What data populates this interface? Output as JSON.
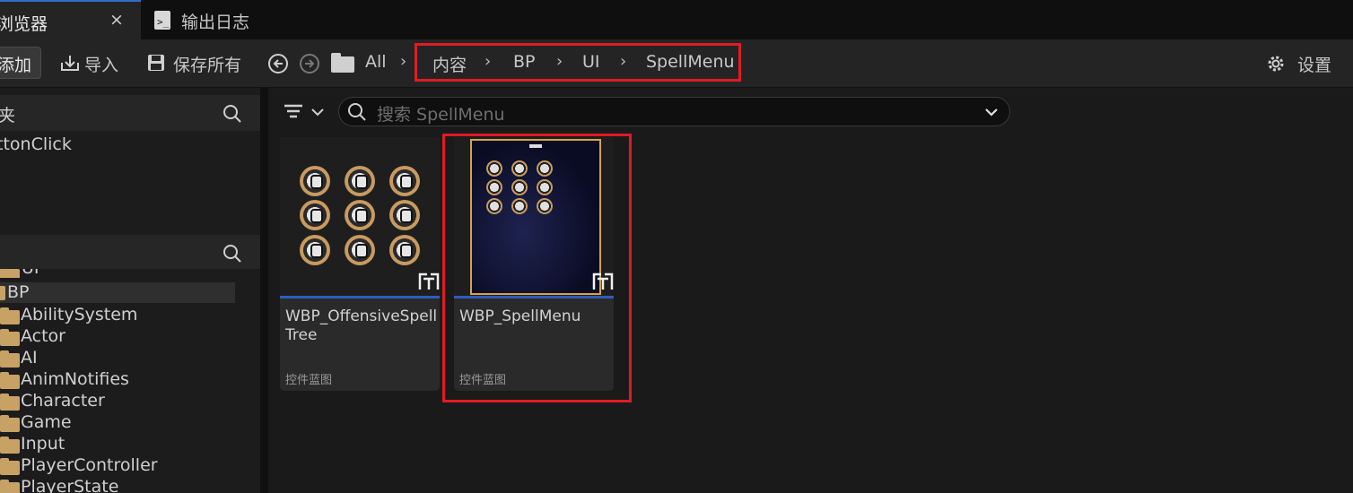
{
  "tabs": [
    {
      "label": "浏览器",
      "close": "×"
    },
    {
      "label": "输出日志"
    }
  ],
  "toolbar": {
    "add_label": "添加",
    "import_label": "导入",
    "save_all_label": "保存所有",
    "path_root": "All",
    "settings_label": "设置"
  },
  "breadcrumb": [
    "内容",
    "BP",
    "UI",
    "SpellMenu"
  ],
  "left_panel": {
    "favorites_header": "夹",
    "favorites_items": [
      "ttonClick"
    ],
    "tree_partial_top": "UI",
    "tree_selected": "BP",
    "tree_items": [
      "AbilitySystem",
      "Actor",
      "AI",
      "AnimNotifies",
      "Character",
      "Game",
      "Input",
      "PlayerController",
      "PlayerState"
    ]
  },
  "search": {
    "placeholder": "搜索 SpellMenu"
  },
  "assets": [
    {
      "name": "WBP_OffensiveSpellTree",
      "type": "控件蓝图"
    },
    {
      "name": "WBP_SpellMenu",
      "type": "控件蓝图"
    }
  ],
  "colors": {
    "accent": "#2f5dbb",
    "highlight_box": "#e01b24",
    "folder": "#c8a165"
  }
}
